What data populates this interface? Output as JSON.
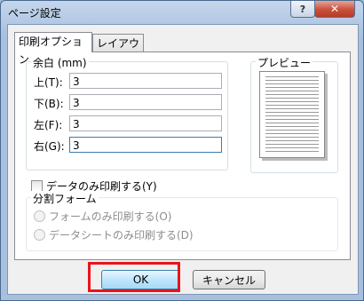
{
  "window": {
    "title": "ページ設定",
    "help_label": "?",
    "close_label": "✕"
  },
  "tabs": [
    {
      "label": "印刷オプション",
      "active": true
    },
    {
      "label": "レイアウト",
      "active": false
    }
  ],
  "margins": {
    "group_label": "余白 (mm)",
    "rows": [
      {
        "label": "上(T):",
        "value": "3"
      },
      {
        "label": "下(B):",
        "value": "3"
      },
      {
        "label": "左(F):",
        "value": "3"
      },
      {
        "label": "右(G):",
        "value": "3"
      }
    ]
  },
  "preview": {
    "group_label": "プレビュー"
  },
  "data_only": {
    "label": "データのみ印刷する(Y)",
    "checked": false
  },
  "split_form": {
    "group_label": "分割フォーム",
    "options": [
      "フォームのみ印刷する(O)",
      "データシートのみ印刷する(D)"
    ]
  },
  "buttons": {
    "ok": "OK",
    "cancel": "キャンセル"
  }
}
